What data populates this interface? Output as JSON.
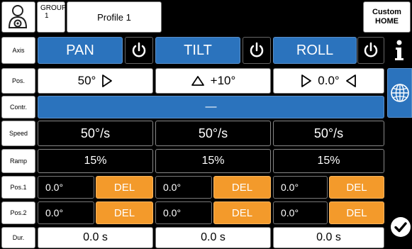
{
  "header": {
    "group_label": "GROUP",
    "group_number": "1",
    "profile_name": "Profile 1",
    "custom_home_line1": "Custom",
    "custom_home_line2": "HOME"
  },
  "row_labels": {
    "axis": "Axis",
    "pos": "Pos.",
    "contr": "Contr.",
    "speed": "Speed",
    "ramp": "Ramp",
    "pos1": "Pos.1",
    "pos2": "Pos.2",
    "dur": "Dur."
  },
  "axes": [
    {
      "name": "PAN",
      "position": "50°",
      "speed": "50°/s",
      "ramp": "15%",
      "pos1": "0.0°",
      "pos2": "0.0°",
      "duration": "0.0 s"
    },
    {
      "name": "TILT",
      "position": "+10°",
      "speed": "50°/s",
      "ramp": "15%",
      "pos1": "0.0°",
      "pos2": "0.0°",
      "duration": "0.0 s"
    },
    {
      "name": "ROLL",
      "position": "0.0°",
      "speed": "50°/s",
      "ramp": "15%",
      "pos1": "0.0°",
      "pos2": "0.0°",
      "duration": "0.0 s"
    }
  ],
  "del_label": "DEL",
  "contr_bar_text": "—",
  "colors": {
    "accent_blue": "#2b73bd",
    "del_orange": "#f39a2b"
  },
  "icons": {
    "settings": "user-gear-icon",
    "power": "power-icon",
    "info": "info-icon",
    "globe": "globe-icon",
    "confirm": "checkmark-icon"
  }
}
